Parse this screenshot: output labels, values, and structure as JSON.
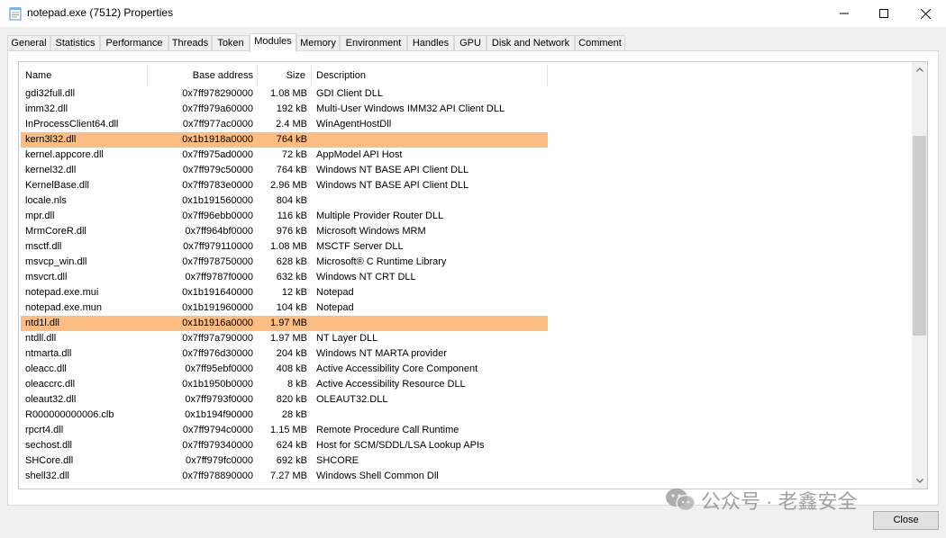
{
  "window": {
    "title": "notepad.exe (7512) Properties"
  },
  "tabs": [
    {
      "label": "General",
      "active": false
    },
    {
      "label": "Statistics",
      "active": false
    },
    {
      "label": "Performance",
      "active": false
    },
    {
      "label": "Threads",
      "active": false
    },
    {
      "label": "Token",
      "active": false
    },
    {
      "label": "Modules",
      "active": true
    },
    {
      "label": "Memory",
      "active": false
    },
    {
      "label": "Environment",
      "active": false
    },
    {
      "label": "Handles",
      "active": false
    },
    {
      "label": "GPU",
      "active": false
    },
    {
      "label": "Disk and Network",
      "active": false
    },
    {
      "label": "Comment",
      "active": false
    }
  ],
  "modules": {
    "columns": {
      "name": "Name",
      "base": "Base address",
      "size": "Size",
      "desc": "Description"
    },
    "rows": [
      {
        "name": "gdi32full.dll",
        "base": "0x7ff978290000",
        "size": "1.08 MB",
        "desc": "GDI Client DLL",
        "highlight": false
      },
      {
        "name": "imm32.dll",
        "base": "0x7ff979a60000",
        "size": "192 kB",
        "desc": "Multi-User Windows IMM32 API Client DLL",
        "highlight": false
      },
      {
        "name": "InProcessClient64.dll",
        "base": "0x7ff977ac0000",
        "size": "2.4 MB",
        "desc": "WinAgentHostDll",
        "highlight": false
      },
      {
        "name": "kern3l32.dll",
        "base": "0x1b1918a0000",
        "size": "764 kB",
        "desc": "",
        "highlight": true
      },
      {
        "name": "kernel.appcore.dll",
        "base": "0x7ff975ad0000",
        "size": "72 kB",
        "desc": "AppModel API Host",
        "highlight": false
      },
      {
        "name": "kernel32.dll",
        "base": "0x7ff979c50000",
        "size": "764 kB",
        "desc": "Windows NT BASE API Client DLL",
        "highlight": false
      },
      {
        "name": "KernelBase.dll",
        "base": "0x7ff9783e0000",
        "size": "2.96 MB",
        "desc": "Windows NT BASE API Client DLL",
        "highlight": false
      },
      {
        "name": "locale.nls",
        "base": "0x1b191560000",
        "size": "804 kB",
        "desc": "",
        "highlight": false
      },
      {
        "name": "mpr.dll",
        "base": "0x7ff96ebb0000",
        "size": "116 kB",
        "desc": "Multiple Provider Router DLL",
        "highlight": false
      },
      {
        "name": "MrmCoreR.dll",
        "base": "0x7ff964bf0000",
        "size": "976 kB",
        "desc": "Microsoft Windows MRM",
        "highlight": false
      },
      {
        "name": "msctf.dll",
        "base": "0x7ff979110000",
        "size": "1.08 MB",
        "desc": "MSCTF Server DLL",
        "highlight": false
      },
      {
        "name": "msvcp_win.dll",
        "base": "0x7ff978750000",
        "size": "628 kB",
        "desc": "Microsoft® C Runtime Library",
        "highlight": false
      },
      {
        "name": "msvcrt.dll",
        "base": "0x7ff9787f0000",
        "size": "632 kB",
        "desc": "Windows NT CRT DLL",
        "highlight": false
      },
      {
        "name": "notepad.exe.mui",
        "base": "0x1b191640000",
        "size": "12 kB",
        "desc": "Notepad",
        "highlight": false
      },
      {
        "name": "notepad.exe.mun",
        "base": "0x1b191960000",
        "size": "104 kB",
        "desc": "Notepad",
        "highlight": false
      },
      {
        "name": "ntd1l.dll",
        "base": "0x1b1916a0000",
        "size": "1.97 MB",
        "desc": "",
        "highlight": true
      },
      {
        "name": "ntdll.dll",
        "base": "0x7ff97a790000",
        "size": "1.97 MB",
        "desc": "NT Layer DLL",
        "highlight": false
      },
      {
        "name": "ntmarta.dll",
        "base": "0x7ff976d30000",
        "size": "204 kB",
        "desc": "Windows NT MARTA provider",
        "highlight": false
      },
      {
        "name": "oleacc.dll",
        "base": "0x7ff95ebf0000",
        "size": "408 kB",
        "desc": "Active Accessibility Core Component",
        "highlight": false
      },
      {
        "name": "oleaccrc.dll",
        "base": "0x1b1950b0000",
        "size": "8 kB",
        "desc": "Active Accessibility Resource DLL",
        "highlight": false
      },
      {
        "name": "oleaut32.dll",
        "base": "0x7ff9793f0000",
        "size": "820 kB",
        "desc": "OLEAUT32.DLL",
        "highlight": false
      },
      {
        "name": "R000000000006.clb",
        "base": "0x1b194f90000",
        "size": "28 kB",
        "desc": "",
        "highlight": false
      },
      {
        "name": "rpcrt4.dll",
        "base": "0x7ff9794c0000",
        "size": "1.15 MB",
        "desc": "Remote Procedure Call Runtime",
        "highlight": false
      },
      {
        "name": "sechost.dll",
        "base": "0x7ff979340000",
        "size": "624 kB",
        "desc": "Host for SCM/SDDL/LSA Lookup APIs",
        "highlight": false
      },
      {
        "name": "SHCore.dll",
        "base": "0x7ff979fc0000",
        "size": "692 kB",
        "desc": "SHCORE",
        "highlight": false
      },
      {
        "name": "shell32.dll",
        "base": "0x7ff978890000",
        "size": "7.27 MB",
        "desc": "Windows Shell Common Dll",
        "highlight": false
      }
    ],
    "scroll_position": 0.3,
    "highlight_color": "#fbbd83"
  },
  "watermark": {
    "text": "公众号 · 老鑫安全"
  },
  "footer": {
    "close_label": "Close"
  }
}
